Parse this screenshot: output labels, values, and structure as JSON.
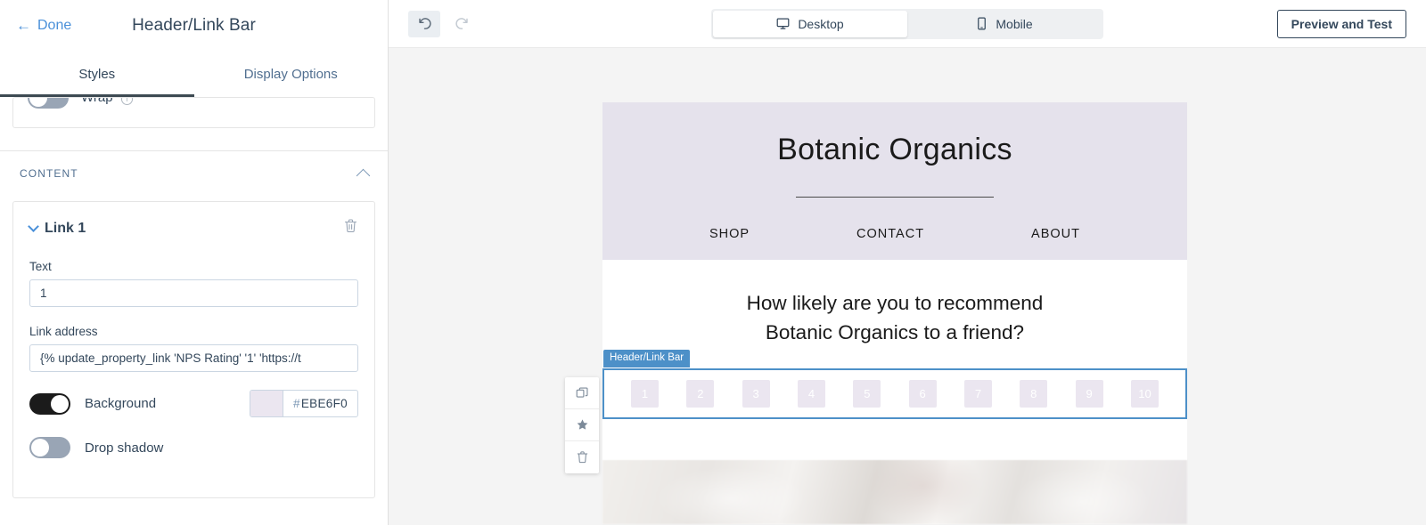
{
  "panel": {
    "done_label": "Done",
    "title": "Header/Link Bar",
    "tabs": [
      {
        "label": "Styles",
        "active": true
      },
      {
        "label": "Display Options",
        "active": false
      }
    ],
    "wrap": {
      "label": "Wrap",
      "enabled": false
    },
    "content_section": {
      "title": "CONTENT"
    },
    "link": {
      "title": "Link 1",
      "text_label": "Text",
      "text_value": "1",
      "link_address_label": "Link address",
      "link_address_value": "{% update_property_link 'NPS Rating' '1' 'https://t",
      "background_label": "Background",
      "background_enabled": true,
      "background_color": "EBE6F0",
      "hash_symbol": "#",
      "drop_shadow_label": "Drop shadow",
      "drop_shadow_enabled": false
    }
  },
  "toolbar": {
    "undo_title": "Undo",
    "redo_title": "Redo",
    "devices": [
      {
        "label": "Desktop",
        "active": true
      },
      {
        "label": "Mobile",
        "active": false
      }
    ],
    "preview_label": "Preview and Test"
  },
  "email": {
    "brand": "Botanic Organics",
    "nav": [
      "SHOP",
      "CONTACT",
      "ABOUT"
    ],
    "question_line1": "How likely are you to recommend",
    "question_line2": "Botanic Organics to a friend?",
    "selection_label": "Header/Link Bar",
    "ratings": [
      "1",
      "2",
      "3",
      "4",
      "5",
      "6",
      "7",
      "8",
      "9",
      "10"
    ]
  },
  "actions": {
    "duplicate": "duplicate",
    "favorite": "favorite",
    "delete": "delete"
  }
}
